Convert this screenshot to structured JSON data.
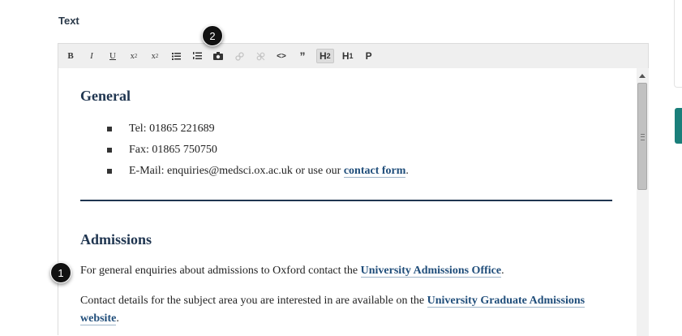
{
  "field": {
    "label": "Text"
  },
  "toolbar": {
    "buttons": [
      {
        "name": "bold-button",
        "glyph": "B"
      },
      {
        "name": "italic-button",
        "glyph": "I"
      },
      {
        "name": "underline-button",
        "glyph": "U"
      },
      {
        "name": "subscript-button",
        "glyph": "x₂"
      },
      {
        "name": "superscript-button",
        "glyph": "x²"
      },
      {
        "name": "bulleted-list-button",
        "glyph": "☰"
      },
      {
        "name": "numbered-list-button",
        "glyph": "☰"
      },
      {
        "name": "insert-image-button",
        "glyph": "📷"
      },
      {
        "name": "link-button",
        "glyph": "🔗"
      },
      {
        "name": "unlink-button",
        "glyph": "⛓"
      },
      {
        "name": "code-button",
        "glyph": "<>"
      },
      {
        "name": "quote-button",
        "glyph": "”"
      },
      {
        "name": "heading2-button",
        "glyph": "H2"
      },
      {
        "name": "heading1-button",
        "glyph": "H1"
      },
      {
        "name": "paragraph-button",
        "glyph": "P"
      }
    ]
  },
  "content": {
    "general_heading": "General",
    "items": [
      {
        "text": "Tel: 01865 221689"
      },
      {
        "text": "Fax: 01865 750750"
      },
      {
        "text": "E-Mail: enquiries@medsci.ox.ac.uk or use our ",
        "link": "contact form",
        "suffix": "."
      }
    ],
    "admissions_heading": "Admissions",
    "p1": {
      "text": "For general enquiries about admissions to Oxford contact the ",
      "link": "University Admissions Office",
      "suffix": "."
    },
    "p2": {
      "text": "Contact details for the subject area you are interested in are available on the ",
      "link": "University Graduate Admissions website",
      "suffix": "."
    }
  },
  "callouts": {
    "one": "1",
    "two": "2"
  }
}
